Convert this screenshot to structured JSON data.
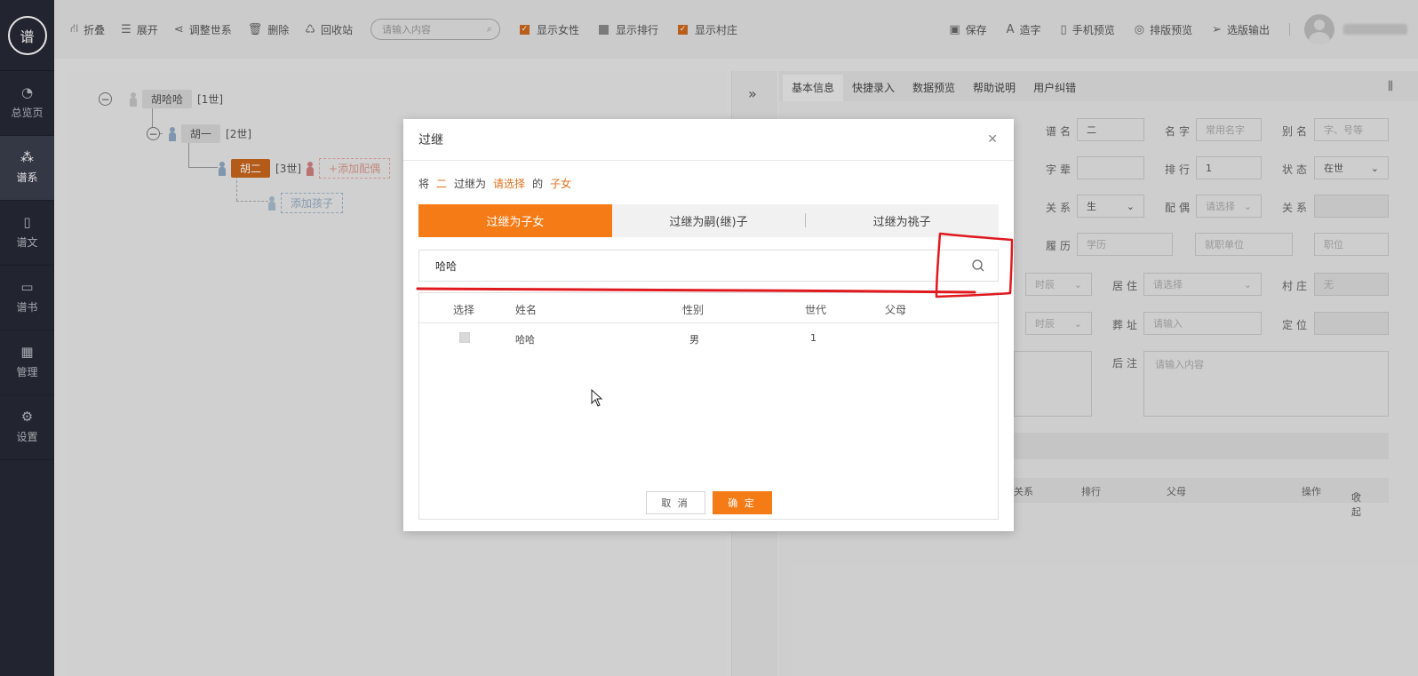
{
  "sidebar": {
    "logo": "谱",
    "items": [
      {
        "label": "总览页",
        "icon": "pie-chart-icon"
      },
      {
        "label": "谱系",
        "icon": "tree-icon"
      },
      {
        "label": "谱文",
        "icon": "document-icon"
      },
      {
        "label": "谱书",
        "icon": "book-icon"
      },
      {
        "label": "管理",
        "icon": "grid-icon"
      },
      {
        "label": "设置",
        "icon": "gear-icon"
      }
    ]
  },
  "toolbar": {
    "collapse": "折叠",
    "expand": "展开",
    "adjust": "调整世系",
    "delete": "删除",
    "recycle": "回收站",
    "search_placeholder": "请输入内容",
    "show_female": "显示女性",
    "show_rank": "显示排行",
    "show_village": "显示村庄",
    "save": "保存",
    "make_char": "造字",
    "mobile_preview": "手机预览",
    "layout_preview": "排版预览",
    "export": "选版输出"
  },
  "tree": {
    "gen1": {
      "name": "胡哈哈",
      "gen": "[1世]"
    },
    "gen2": {
      "name": "胡一",
      "gen": "[2世]"
    },
    "gen3": {
      "name": "胡二",
      "gen": "[3世]"
    },
    "add_spouse": "+添加配偶",
    "add_child": "添加孩子"
  },
  "right_panel": {
    "tabs": [
      "基本信息",
      "快捷录入",
      "数据预览",
      "帮助说明",
      "用户纠错"
    ],
    "fields": {
      "pu_name_label": "谱名",
      "pu_name_value": "二",
      "name_label": "名字",
      "name_placeholder": "常用名字",
      "alias_label": "别名",
      "alias_placeholder": "字、号等",
      "zibei_label": "字辈",
      "rank_label": "排行",
      "rank_value": "1",
      "status_label": "状态",
      "status_value": "在世",
      "relation_label": "关系",
      "relation_value": "生",
      "spouse_label": "配偶",
      "spouse_placeholder": "请选择",
      "relation2_label": "关系",
      "resume_label": "履历",
      "edu_placeholder": "学历",
      "work_placeholder": "就职单位",
      "post_placeholder": "职位",
      "time1": "时辰",
      "reside_label": "居住",
      "reside_placeholder": "请选择",
      "village_label": "村庄",
      "village_value": "无",
      "time2": "时辰",
      "burial_label": "葬址",
      "burial_placeholder": "请输入",
      "locate_label": "定位",
      "postnote_label": "后注",
      "postnote_placeholder": "请输入内容"
    },
    "table_head": [
      "关系",
      "排行",
      "父母",
      "操作",
      "收起"
    ]
  },
  "modal": {
    "title": "过继",
    "desc": {
      "prefix": "将",
      "person": "二",
      "middle": "过继为",
      "target": "请选择",
      "of": "的",
      "type": "子女"
    },
    "tabs": [
      "过继为子女",
      "过继为嗣(继)子",
      "过继为祧子"
    ],
    "search_value": "哈哈",
    "columns": [
      "选择",
      "姓名",
      "性别",
      "世代",
      "父母"
    ],
    "rows": [
      {
        "name": "哈哈",
        "gender": "男",
        "gen": "1",
        "parents": ""
      }
    ],
    "cancel": "取 消",
    "ok": "确 定"
  },
  "colors": {
    "accent": "#f47b16",
    "sidebar": "#262a35",
    "annotation": "#e0191f"
  }
}
